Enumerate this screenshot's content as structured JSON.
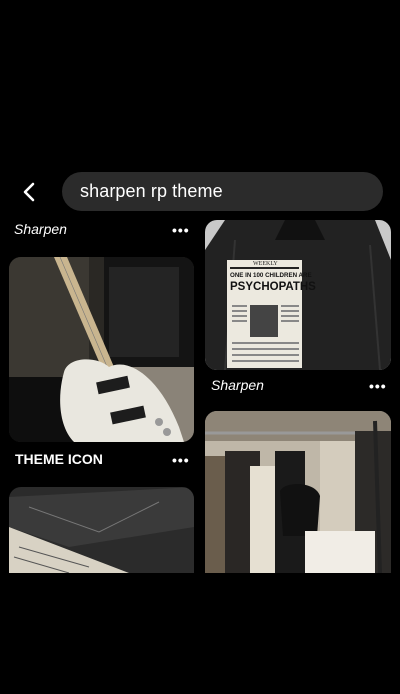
{
  "search": {
    "query": "sharpen rp theme"
  },
  "pins": [
    {
      "title": "Sharpen",
      "more": "•••"
    },
    {
      "title": "Sharpen",
      "more": "•••"
    },
    {
      "title": "THEME ICON",
      "more": "•••"
    }
  ],
  "jacket_print": {
    "masthead": "WEEKLY",
    "headline": "ONE IN 100 CHILDREN ARE",
    "headline_big": "PSYCHOPATHS"
  },
  "colors": {
    "search_bg": "#2b2b2b",
    "background": "#000000"
  }
}
